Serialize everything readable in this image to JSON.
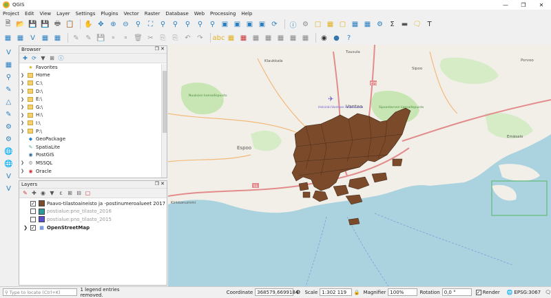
{
  "window": {
    "title": "QGIS"
  },
  "menu": [
    "Project",
    "Edit",
    "View",
    "Layer",
    "Settings",
    "Plugins",
    "Vector",
    "Raster",
    "Database",
    "Web",
    "Processing",
    "Help"
  ],
  "browser": {
    "title": "Browser",
    "items": [
      {
        "label": "Favorites",
        "icon": "star-icon"
      },
      {
        "label": "Home",
        "icon": "folder-icon"
      },
      {
        "label": "C:\\",
        "icon": "folder-icon"
      },
      {
        "label": "D:\\",
        "icon": "folder-icon"
      },
      {
        "label": "E:\\",
        "icon": "folder-icon"
      },
      {
        "label": "G:\\",
        "icon": "folder-icon"
      },
      {
        "label": "H:\\",
        "icon": "folder-icon"
      },
      {
        "label": "I:\\",
        "icon": "folder-icon"
      },
      {
        "label": "P:\\",
        "icon": "folder-icon"
      },
      {
        "label": "GeoPackage",
        "icon": "geopackage-icon"
      },
      {
        "label": "SpatiaLite",
        "icon": "spatialite-icon"
      },
      {
        "label": "PostGIS",
        "icon": "postgis-icon"
      },
      {
        "label": "MSSQL",
        "icon": "mssql-icon"
      },
      {
        "label": "Oracle",
        "icon": "oracle-icon"
      }
    ]
  },
  "layers": {
    "title": "Layers",
    "items": [
      {
        "label": "Paavo-tilastoaineisto ja -postinumeroalueet 2017",
        "checked": true,
        "color": "#7b4a2a",
        "active": true
      },
      {
        "label": "postialue:pno_tilasto_2016",
        "checked": false,
        "color": "#2e9b9b",
        "active": false
      },
      {
        "label": "postialue:pno_tilasto_2015",
        "checked": false,
        "color": "#5a4fcf",
        "active": false
      },
      {
        "label": "OpenStreetMap",
        "checked": true,
        "color": "#3366cc",
        "active": true
      }
    ]
  },
  "map": {
    "labels": {
      "klaukkala": "Klaukkala",
      "tuusula": "Tuusula",
      "sipoo": "Sipoo",
      "porvoo": "Porvoo",
      "vantaa": "Vantaa",
      "espoo": "Espoo",
      "kirkkonummi": "Kirkkonummi",
      "emasalo": "Emäsalo",
      "nuuksio": "Nuuksion kansallispuisto",
      "sipoonkorpi": "Sipoonkorven kansallispuisto",
      "airport": "Helsinki-Vantaan lentoasema",
      "road_e75": "E75",
      "road_51": "51"
    }
  },
  "status": {
    "locate_placeholder": "Type to locate (Ctrl+K)",
    "message": "1 legend entries removed.",
    "coordinate_label": "Coordinate",
    "coordinate_value": "368579,6699184",
    "scale_label": "Scale",
    "scale_value": "1:302 119",
    "magnifier_label": "Magnifier",
    "magnifier_value": "100%",
    "rotation_label": "Rotation",
    "rotation_value": "0,0 °",
    "render_label": "Render",
    "crs": "EPSG:3067"
  },
  "colors": {
    "polygon_fill": "#7b4a2a",
    "sea": "#aad3df",
    "land": "#f2efe9",
    "forest": "#c8e6b4"
  }
}
